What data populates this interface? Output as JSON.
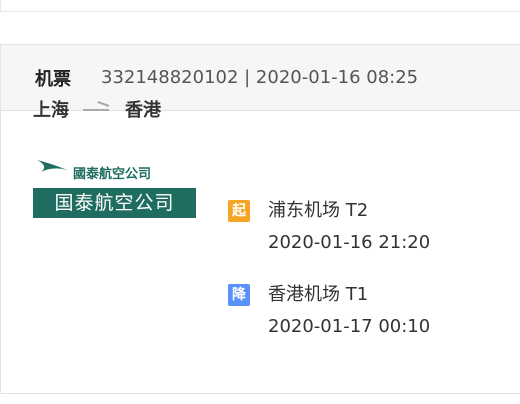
{
  "header": {
    "title": "机票",
    "ticket_info": "332148820102 | 2020-01-16 08:25"
  },
  "route": {
    "origin": "上海",
    "destination": "香港"
  },
  "airline": {
    "top_text": "國泰航空公司",
    "bottom_text": "国泰航空公司",
    "brand_color": "#1f6d60"
  },
  "departure": {
    "badge": "起",
    "airport": "浦东机场 T2",
    "time": "2020-01-16 21:20",
    "badge_color": "#f5a524"
  },
  "arrival": {
    "badge": "降",
    "airport": "香港机场 T1",
    "time": "2020-01-17 00:10",
    "badge_color": "#5b8ff9"
  }
}
